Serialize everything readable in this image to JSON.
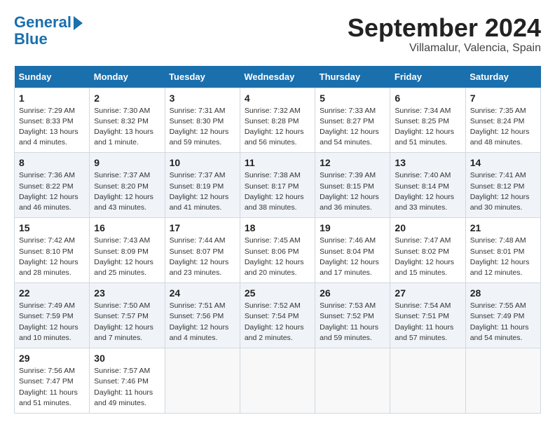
{
  "header": {
    "logo_line1": "General",
    "logo_line2": "Blue",
    "month_title": "September 2024",
    "location": "Villamalur, Valencia, Spain"
  },
  "calendar": {
    "weekdays": [
      "Sunday",
      "Monday",
      "Tuesday",
      "Wednesday",
      "Thursday",
      "Friday",
      "Saturday"
    ],
    "weeks": [
      [
        null,
        null,
        null,
        null,
        null,
        null,
        {
          "day": 1,
          "sunrise": "7:29 AM",
          "sunset": "8:33 PM",
          "daylight": "13 hours and 4 minutes"
        }
      ],
      [
        {
          "day": 1,
          "sunrise": "7:29 AM",
          "sunset": "8:33 PM",
          "daylight": "13 hours and 4 minutes"
        },
        {
          "day": 2,
          "sunrise": "7:30 AM",
          "sunset": "8:32 PM",
          "daylight": "13 hours and 1 minute"
        },
        {
          "day": 3,
          "sunrise": "7:31 AM",
          "sunset": "8:30 PM",
          "daylight": "12 hours and 59 minutes"
        },
        {
          "day": 4,
          "sunrise": "7:32 AM",
          "sunset": "8:28 PM",
          "daylight": "12 hours and 56 minutes"
        },
        {
          "day": 5,
          "sunrise": "7:33 AM",
          "sunset": "8:27 PM",
          "daylight": "12 hours and 54 minutes"
        },
        {
          "day": 6,
          "sunrise": "7:34 AM",
          "sunset": "8:25 PM",
          "daylight": "12 hours and 51 minutes"
        },
        {
          "day": 7,
          "sunrise": "7:35 AM",
          "sunset": "8:24 PM",
          "daylight": "12 hours and 48 minutes"
        }
      ],
      [
        {
          "day": 8,
          "sunrise": "7:36 AM",
          "sunset": "8:22 PM",
          "daylight": "12 hours and 46 minutes"
        },
        {
          "day": 9,
          "sunrise": "7:37 AM",
          "sunset": "8:20 PM",
          "daylight": "12 hours and 43 minutes"
        },
        {
          "day": 10,
          "sunrise": "7:37 AM",
          "sunset": "8:19 PM",
          "daylight": "12 hours and 41 minutes"
        },
        {
          "day": 11,
          "sunrise": "7:38 AM",
          "sunset": "8:17 PM",
          "daylight": "12 hours and 38 minutes"
        },
        {
          "day": 12,
          "sunrise": "7:39 AM",
          "sunset": "8:15 PM",
          "daylight": "12 hours and 36 minutes"
        },
        {
          "day": 13,
          "sunrise": "7:40 AM",
          "sunset": "8:14 PM",
          "daylight": "12 hours and 33 minutes"
        },
        {
          "day": 14,
          "sunrise": "7:41 AM",
          "sunset": "8:12 PM",
          "daylight": "12 hours and 30 minutes"
        }
      ],
      [
        {
          "day": 15,
          "sunrise": "7:42 AM",
          "sunset": "8:10 PM",
          "daylight": "12 hours and 28 minutes"
        },
        {
          "day": 16,
          "sunrise": "7:43 AM",
          "sunset": "8:09 PM",
          "daylight": "12 hours and 25 minutes"
        },
        {
          "day": 17,
          "sunrise": "7:44 AM",
          "sunset": "8:07 PM",
          "daylight": "12 hours and 23 minutes"
        },
        {
          "day": 18,
          "sunrise": "7:45 AM",
          "sunset": "8:06 PM",
          "daylight": "12 hours and 20 minutes"
        },
        {
          "day": 19,
          "sunrise": "7:46 AM",
          "sunset": "8:04 PM",
          "daylight": "12 hours and 17 minutes"
        },
        {
          "day": 20,
          "sunrise": "7:47 AM",
          "sunset": "8:02 PM",
          "daylight": "12 hours and 15 minutes"
        },
        {
          "day": 21,
          "sunrise": "7:48 AM",
          "sunset": "8:01 PM",
          "daylight": "12 hours and 12 minutes"
        }
      ],
      [
        {
          "day": 22,
          "sunrise": "7:49 AM",
          "sunset": "7:59 PM",
          "daylight": "12 hours and 10 minutes"
        },
        {
          "day": 23,
          "sunrise": "7:50 AM",
          "sunset": "7:57 PM",
          "daylight": "12 hours and 7 minutes"
        },
        {
          "day": 24,
          "sunrise": "7:51 AM",
          "sunset": "7:56 PM",
          "daylight": "12 hours and 4 minutes"
        },
        {
          "day": 25,
          "sunrise": "7:52 AM",
          "sunset": "7:54 PM",
          "daylight": "12 hours and 2 minutes"
        },
        {
          "day": 26,
          "sunrise": "7:53 AM",
          "sunset": "7:52 PM",
          "daylight": "11 hours and 59 minutes"
        },
        {
          "day": 27,
          "sunrise": "7:54 AM",
          "sunset": "7:51 PM",
          "daylight": "11 hours and 57 minutes"
        },
        {
          "day": 28,
          "sunrise": "7:55 AM",
          "sunset": "7:49 PM",
          "daylight": "11 hours and 54 minutes"
        }
      ],
      [
        {
          "day": 29,
          "sunrise": "7:56 AM",
          "sunset": "7:47 PM",
          "daylight": "11 hours and 51 minutes"
        },
        {
          "day": 30,
          "sunrise": "7:57 AM",
          "sunset": "7:46 PM",
          "daylight": "11 hours and 49 minutes"
        },
        null,
        null,
        null,
        null,
        null
      ]
    ]
  }
}
